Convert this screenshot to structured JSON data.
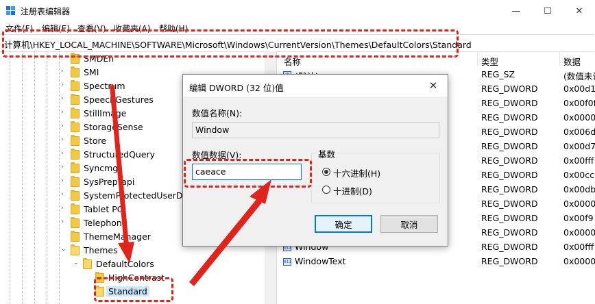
{
  "window": {
    "title": "注册表编辑器",
    "controls": [
      "—",
      "☐",
      "✕"
    ]
  },
  "menu": [
    "文件(F)",
    "编辑(E)",
    "查看(V)",
    "收藏夹(A)",
    "帮助(H)"
  ],
  "address": "计算机\\HKEY_LOCAL_MACHINE\\SOFTWARE\\Microsoft\\Windows\\CurrentVersion\\Themes\\DefaultColors\\Standard",
  "tree": {
    "items": [
      {
        "label": "SMDEn",
        "chevron": "›"
      },
      {
        "label": "SMI",
        "chevron": "›"
      },
      {
        "label": "Spectrum",
        "chevron": "›"
      },
      {
        "label": "SpeechGestures",
        "chevron": "›"
      },
      {
        "label": "StillImage",
        "chevron": "›"
      },
      {
        "label": "StorageSense",
        "chevron": "›"
      },
      {
        "label": "Store",
        "chevron": "›"
      },
      {
        "label": "StructuredQuery",
        "chevron": "›"
      },
      {
        "label": "Syncmgr",
        "chevron": "›"
      },
      {
        "label": "SysPrepTapi",
        "chevron": "›"
      },
      {
        "label": "SystemProtectedUserData",
        "chevron": "›"
      },
      {
        "label": "Tablet PC",
        "chevron": "›"
      },
      {
        "label": "Telephony",
        "chevron": "›"
      },
      {
        "label": "ThemeManager",
        "chevron": ""
      },
      {
        "label": "Themes",
        "chevron": "⌄"
      },
      {
        "label": "DefaultColors",
        "chevron": "⌄"
      },
      {
        "label": "HighContrast",
        "chevron": ""
      },
      {
        "label": "Standard",
        "chevron": ""
      }
    ]
  },
  "values": {
    "headers": {
      "name": "名称",
      "type": "类型",
      "data": "数据"
    },
    "rows": [
      {
        "name": "(默认)",
        "type": "REG_SZ",
        "data": "(数值未设"
      },
      {
        "name": "",
        "type": "REG_DWORD",
        "data": "0x00d1"
      },
      {
        "name": "",
        "type": "REG_DWORD",
        "data": "0x00f0f"
      },
      {
        "name": "",
        "type": "REG_DWORD",
        "data": "0x0000("
      },
      {
        "name": "",
        "type": "REG_DWORD",
        "data": "0x006d("
      },
      {
        "name": "",
        "type": "REG_DWORD",
        "data": "0x00d7"
      },
      {
        "name": "",
        "type": "REG_DWORD",
        "data": "0x00fff"
      },
      {
        "name": "",
        "type": "REG_DWORD",
        "data": "0x00cc6"
      },
      {
        "name": "",
        "type": "REG_DWORD",
        "data": "0x00db"
      },
      {
        "name": "",
        "type": "REG_DWORD",
        "data": "0x0000("
      },
      {
        "name": "",
        "type": "REG_DWORD",
        "data": "0x00f9"
      },
      {
        "name": "",
        "type": "REG_DWORD",
        "data": "0x0000("
      },
      {
        "name": "Window",
        "type": "REG_DWORD",
        "data": "0x00fff"
      },
      {
        "name": "WindowText",
        "type": "REG_DWORD",
        "data": "0x0000("
      }
    ]
  },
  "dialog": {
    "title": "编辑 DWORD (32 位)值",
    "close": "✕",
    "name_label": "数值名称(N):",
    "name_value": "Window",
    "data_label": "数值数据(V):",
    "data_value": "caeace",
    "base_label": "基数",
    "radio_hex": "十六进制(H)",
    "radio_dec": "十进制(D)",
    "base_selected": "hex",
    "ok": "确定",
    "cancel": "取消"
  },
  "annotations": {
    "color": "#e0231b"
  }
}
